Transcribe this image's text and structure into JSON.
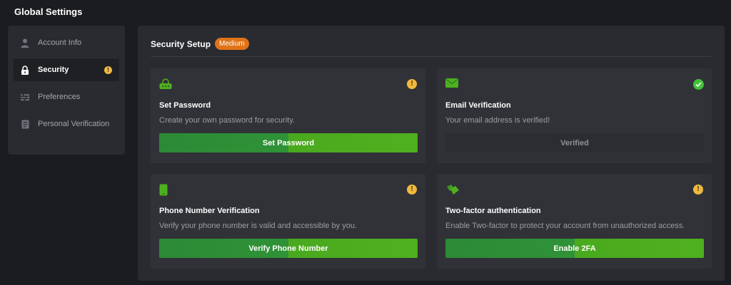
{
  "page": {
    "title": "Global Settings"
  },
  "sidebar": {
    "items": [
      {
        "label": "Account Info",
        "icon": "user-icon"
      },
      {
        "label": "Security",
        "icon": "lock-icon",
        "active": true,
        "warning": "!"
      },
      {
        "label": "Preferences",
        "icon": "sliders-icon"
      },
      {
        "label": "Personal Verification",
        "icon": "id-document-icon"
      }
    ]
  },
  "main": {
    "title": "Security Setup",
    "badge": "Medium",
    "cards": [
      {
        "title": "Set Password",
        "description": "Create your own password for security.",
        "button": "Set Password",
        "status": "warning",
        "status_glyph": "!",
        "icon": "password-icon"
      },
      {
        "title": "Email Verification",
        "description": "Your email address is verified!",
        "button": "Verified",
        "status": "verified",
        "icon": "envelope-icon"
      },
      {
        "title": "Phone Number Verification",
        "description": "Verify your phone number is valid and accessible by you.",
        "button": "Verify Phone Number",
        "status": "warning",
        "status_glyph": "!",
        "icon": "phone-icon"
      },
      {
        "title": "Two-factor authentication",
        "description": "Enable Two-factor to protect your account from unauthorized access.",
        "button": "Enable 2FA",
        "status": "warning",
        "status_glyph": "!",
        "icon": "two-factor-icon"
      }
    ]
  },
  "colors": {
    "background": "#1b1c20",
    "panel": "#2a2b30",
    "card": "#313237",
    "accent_green": "#4fb01f",
    "badge_orange": "#e07318",
    "warning_yellow": "#f1b93c",
    "success_green": "#44c13a"
  }
}
